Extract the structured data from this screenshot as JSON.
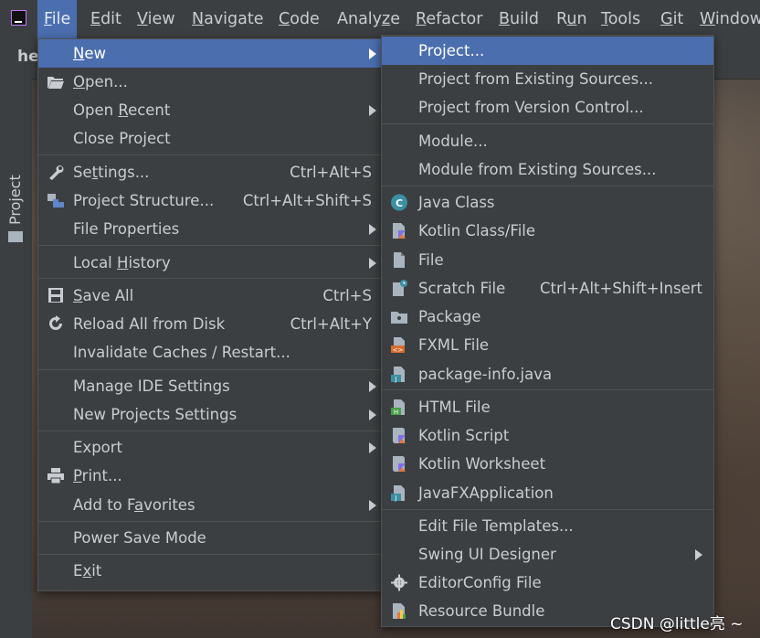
{
  "menubar": {
    "items": [
      {
        "label": "File",
        "mnemonic": "F",
        "rest": "ile",
        "active": true
      },
      {
        "label": "Edit",
        "mnemonic": "E",
        "rest": "dit"
      },
      {
        "label": "View",
        "mnemonic": "V",
        "rest": "iew"
      },
      {
        "label": "Navigate",
        "mnemonic": "N",
        "rest": "avigate"
      },
      {
        "label": "Code",
        "mnemonic": "C",
        "rest": "ode"
      },
      {
        "label": "Analyze",
        "pre": "Analy",
        "mnemonic": "z",
        "rest": "e"
      },
      {
        "label": "Refactor",
        "mnemonic": "R",
        "rest": "efactor"
      },
      {
        "label": "Build",
        "mnemonic": "B",
        "rest": "uild"
      },
      {
        "label": "Run",
        "pre": "R",
        "mnemonic": "u",
        "rest": "n"
      },
      {
        "label": "Tools",
        "mnemonic": "T",
        "rest": "ools"
      },
      {
        "label": "Git",
        "mnemonic": "G",
        "rest": "it"
      },
      {
        "label": "Window",
        "mnemonic": "W",
        "rest": "indow"
      }
    ]
  },
  "tab": {
    "title": "he"
  },
  "tool_window": {
    "label": "Project"
  },
  "file_menu": {
    "items": [
      {
        "pre": "",
        "mn": "N",
        "rest": "ew",
        "shortcut": "",
        "submenu": true,
        "highlight": true,
        "icon": ""
      },
      {
        "pre": "",
        "mn": "O",
        "rest": "pen...",
        "shortcut": "",
        "icon": "folder-open-icon"
      },
      {
        "pre": "Open ",
        "mn": "R",
        "rest": "ecent",
        "shortcut": "",
        "submenu": true,
        "icon": ""
      },
      {
        "pre": "Close Project",
        "mn": "",
        "rest": "",
        "shortcut": "",
        "icon": ""
      },
      {
        "pre": "Se",
        "mn": "t",
        "rest": "tings...",
        "shortcut": "Ctrl+Alt+S",
        "icon": "wrench-icon"
      },
      {
        "pre": "Project Structure...",
        "mn": "",
        "rest": "",
        "shortcut": "Ctrl+Alt+Shift+S",
        "icon": "project-structure-icon"
      },
      {
        "pre": "File Properties",
        "mn": "",
        "rest": "",
        "shortcut": "",
        "submenu": true,
        "icon": ""
      },
      {
        "pre": "Local ",
        "mn": "H",
        "rest": "istory",
        "shortcut": "",
        "submenu": true,
        "icon": ""
      },
      {
        "pre": "",
        "mn": "S",
        "rest": "ave All",
        "shortcut": "Ctrl+S",
        "icon": "save-icon"
      },
      {
        "pre": "Reload All from Disk",
        "mn": "",
        "rest": "",
        "shortcut": "Ctrl+Alt+Y",
        "icon": "reload-icon"
      },
      {
        "pre": "Invalidate Caches / Restart...",
        "mn": "",
        "rest": "",
        "shortcut": "",
        "icon": ""
      },
      {
        "pre": "Manage IDE Settings",
        "mn": "",
        "rest": "",
        "shortcut": "",
        "submenu": true,
        "icon": ""
      },
      {
        "pre": "New Projects Settings",
        "mn": "",
        "rest": "",
        "shortcut": "",
        "submenu": true,
        "icon": ""
      },
      {
        "pre": "Export",
        "mn": "",
        "rest": "",
        "shortcut": "",
        "submenu": true,
        "icon": ""
      },
      {
        "pre": "",
        "mn": "P",
        "rest": "rint...",
        "shortcut": "",
        "icon": "print-icon"
      },
      {
        "pre": "Add to F",
        "mn": "a",
        "rest": "vorites",
        "shortcut": "",
        "submenu": true,
        "icon": ""
      },
      {
        "pre": "Power Save Mode",
        "mn": "",
        "rest": "",
        "shortcut": "",
        "icon": ""
      },
      {
        "pre": "E",
        "mn": "x",
        "rest": "it",
        "shortcut": "",
        "icon": ""
      }
    ]
  },
  "new_menu": {
    "items": [
      {
        "label": "Project...",
        "shortcut": "",
        "highlight": true,
        "icon": ""
      },
      {
        "label": "Project from Existing Sources...",
        "shortcut": "",
        "icon": ""
      },
      {
        "label": "Project from Version Control...",
        "shortcut": "",
        "icon": ""
      },
      {
        "label": "Module...",
        "shortcut": "",
        "icon": ""
      },
      {
        "label": "Module from Existing Sources...",
        "shortcut": "",
        "icon": ""
      },
      {
        "label": "Java Class",
        "shortcut": "",
        "icon": "java-class-icon"
      },
      {
        "label": "Kotlin Class/File",
        "shortcut": "",
        "icon": "kotlin-file-icon"
      },
      {
        "label": "File",
        "shortcut": "",
        "icon": "file-icon"
      },
      {
        "label": "Scratch File",
        "shortcut": "Ctrl+Alt+Shift+Insert",
        "icon": "scratch-file-icon"
      },
      {
        "label": "Package",
        "shortcut": "",
        "icon": "package-icon"
      },
      {
        "label": "FXML File",
        "shortcut": "",
        "icon": "fxml-file-icon"
      },
      {
        "label": "package-info.java",
        "shortcut": "",
        "icon": "java-file-icon"
      },
      {
        "label": "HTML File",
        "shortcut": "",
        "icon": "html-file-icon"
      },
      {
        "label": "Kotlin Script",
        "shortcut": "",
        "icon": "kotlin-script-icon"
      },
      {
        "label": "Kotlin Worksheet",
        "shortcut": "",
        "icon": "kotlin-worksheet-icon"
      },
      {
        "label": "JavaFXApplication",
        "shortcut": "",
        "icon": "javafx-file-icon"
      },
      {
        "label": "Edit File Templates...",
        "shortcut": "",
        "icon": ""
      },
      {
        "label": "Swing UI Designer",
        "shortcut": "",
        "submenu": true,
        "icon": ""
      },
      {
        "label": "EditorConfig File",
        "shortcut": "",
        "icon": "gear-icon"
      },
      {
        "label": "Resource Bundle",
        "shortcut": "",
        "icon": "resource-bundle-icon"
      }
    ]
  },
  "watermark": {
    "text": "CSDN @little亮 ~"
  },
  "colors": {
    "highlight": "#4b6eaf",
    "menu_bg": "#3c3f41",
    "text": "#c9cdd2"
  }
}
